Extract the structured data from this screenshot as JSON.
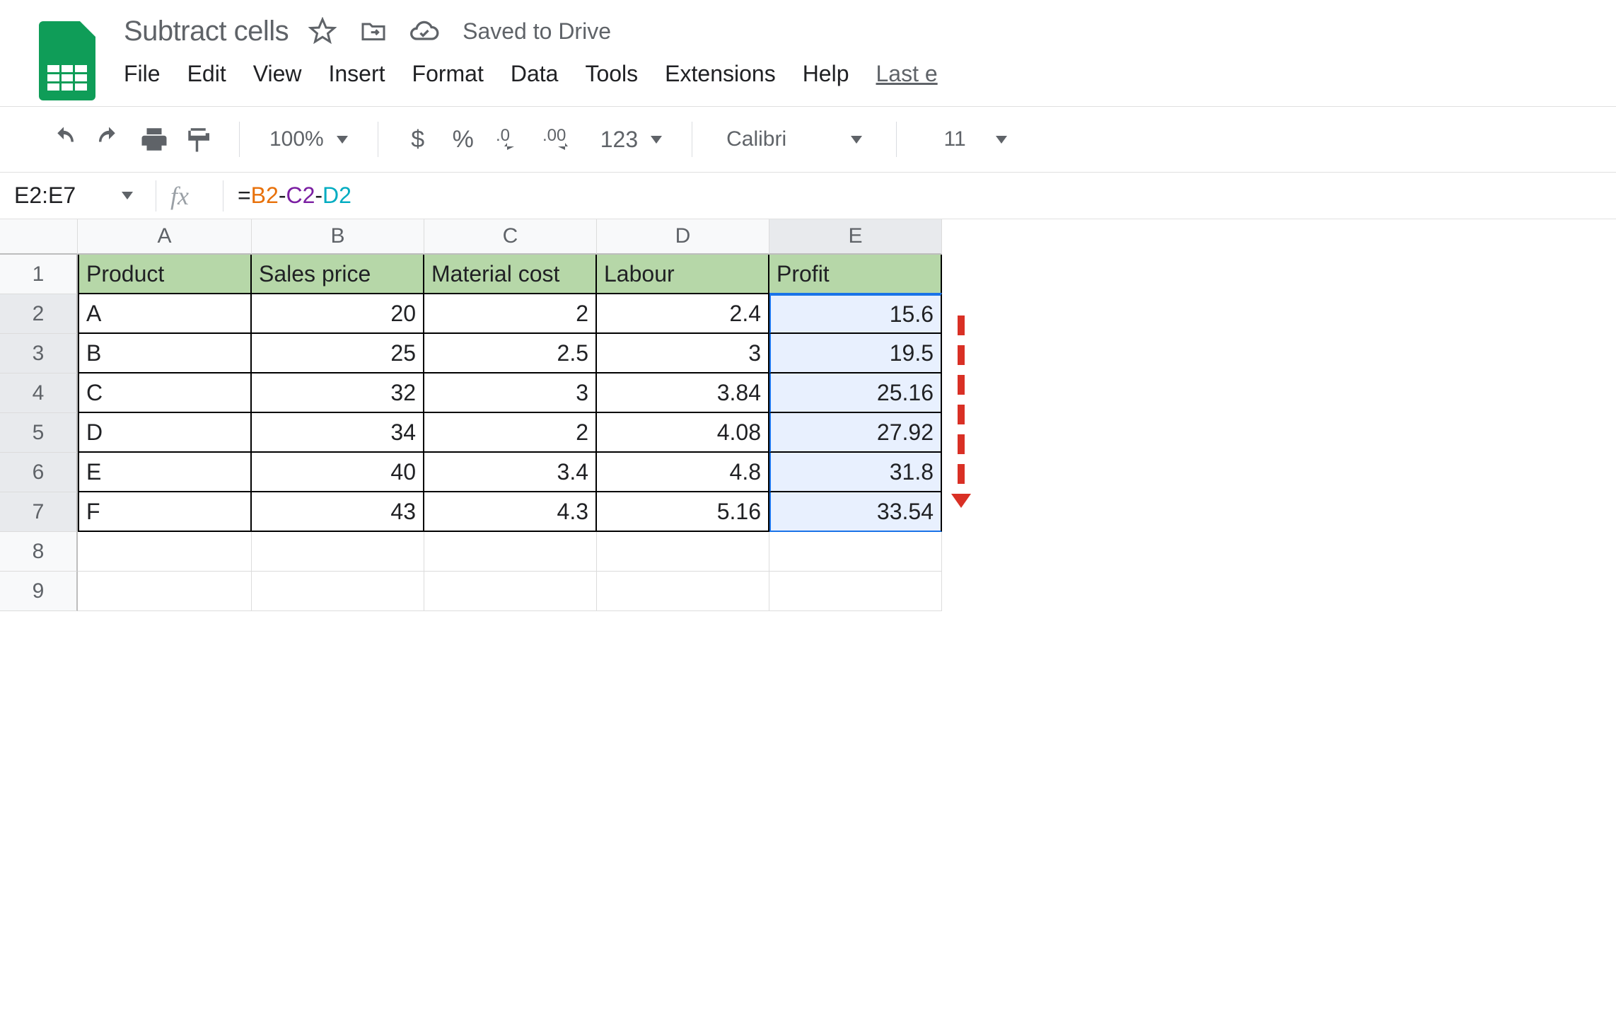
{
  "title": "Subtract cells",
  "saved_text": "Saved to Drive",
  "menu": [
    "File",
    "Edit",
    "View",
    "Insert",
    "Format",
    "Data",
    "Tools",
    "Extensions",
    "Help"
  ],
  "last_edit": "Last e",
  "toolbar": {
    "zoom": "100%",
    "font": "Calibri",
    "font_size": "11"
  },
  "formula": {
    "name_box": "E2:E7",
    "equals": "=",
    "b": "B2",
    "c": "C2",
    "d": "D2"
  },
  "columns": [
    "A",
    "B",
    "C",
    "D",
    "E"
  ],
  "rows": [
    "1",
    "2",
    "3",
    "4",
    "5",
    "6",
    "7",
    "8",
    "9"
  ],
  "headers": [
    "Product",
    "Sales price",
    "Material cost",
    "Labour",
    "Profit"
  ],
  "table": [
    {
      "p": "A",
      "sp": "20",
      "mc": "2",
      "l": "2.4",
      "pr": "15.6"
    },
    {
      "p": "B",
      "sp": "25",
      "mc": "2.5",
      "l": "3",
      "pr": "19.5"
    },
    {
      "p": "C",
      "sp": "32",
      "mc": "3",
      "l": "3.84",
      "pr": "25.16"
    },
    {
      "p": "D",
      "sp": "34",
      "mc": "2",
      "l": "4.08",
      "pr": "27.92"
    },
    {
      "p": "E",
      "sp": "40",
      "mc": "3.4",
      "l": "4.8",
      "pr": "31.8"
    },
    {
      "p": "F",
      "sp": "43",
      "mc": "4.3",
      "l": "5.16",
      "pr": "33.54"
    }
  ]
}
